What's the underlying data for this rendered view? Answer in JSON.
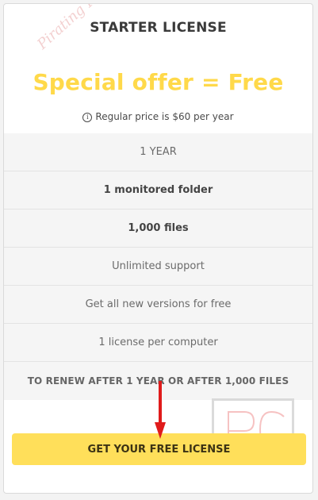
{
  "card": {
    "title": "STARTER LICENSE",
    "offer_title": "Special offer = Free",
    "regular_price_icon": "info-icon",
    "regular_price_text": "Regular price is $60 per year"
  },
  "features": [
    "1 YEAR",
    "1 monitored folder",
    "1,000 files",
    "Unlimited support",
    "Get all new versions for free",
    "1 license per computer",
    "TO RENEW AFTER 1 YEAR OR AFTER 1,000 FILES"
  ],
  "cta": {
    "label": "GET YOUR FREE LICENSE"
  },
  "watermark": {
    "text": "Pirating PC",
    "logo_text": "PC"
  },
  "colors": {
    "offer": "#ffd94a",
    "button": "#ffdf5a",
    "arrow": "#e01b1b"
  }
}
